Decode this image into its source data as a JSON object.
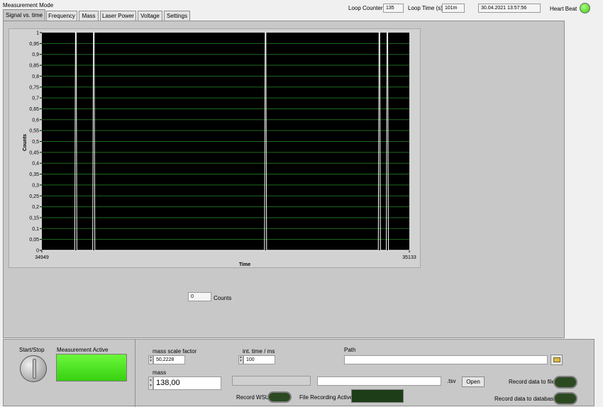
{
  "header": {
    "mode_label": "Measurement Mode",
    "loop_counter_label": "Loop Counter",
    "loop_counter_value": "135",
    "loop_time_label": "Loop Time (s)",
    "loop_time_value": "101m",
    "datetime": "30.04.2021 13:57:56",
    "heartbeat_label": "Heart Beat"
  },
  "tabs": [
    {
      "label": "Signal vs. time"
    },
    {
      "label": "Frequency"
    },
    {
      "label": "Mass"
    },
    {
      "label": "Laser Power"
    },
    {
      "label": "Voltage"
    },
    {
      "label": "Settings"
    }
  ],
  "counts_indicator": {
    "value": "0",
    "label": "Counts"
  },
  "chart_data": {
    "type": "line",
    "xlabel": "Time",
    "ylabel": "Counts",
    "x_range": [
      34949,
      35133
    ],
    "ylim": [
      0,
      1
    ],
    "y_ticks": [
      "0",
      "0,05",
      "0,1",
      "0,15",
      "0,2",
      "0,25",
      "0,3",
      "0,35",
      "0,4",
      "0,45",
      "0,5",
      "0,55",
      "0,6",
      "0,65",
      "0,7",
      "0,75",
      "0,8",
      "0,85",
      "0,9",
      "0,95",
      "1"
    ],
    "x_tick_labels": [
      "34949",
      "35133"
    ],
    "grid": true,
    "background": "#000000",
    "grid_color": "#1e6b1e",
    "line_color": "#ffffff",
    "peaks": [
      {
        "x": 34966,
        "y": 1
      },
      {
        "x": 34975,
        "y": 1
      },
      {
        "x": 35061,
        "y": 1
      },
      {
        "x": 35118,
        "y": 1
      },
      {
        "x": 35122,
        "y": 1
      }
    ]
  },
  "bottom": {
    "start_stop_label": "Start/Stop",
    "measurement_active_label": "Measurement Active",
    "mass_scale_factor_label": "mass scale factor",
    "mass_scale_factor_value": "50,2228",
    "int_time_label": "int. time / ms",
    "int_time_value": "100",
    "mass_label": "mass",
    "mass_value": "138,00",
    "path_label": "Path",
    "path_value": "",
    "tsv_label": ".tsv",
    "open_button": "Open",
    "record_wsu_label": "Record WSU",
    "file_recording_label": "File Recording Active",
    "record_file_label": "Record data to file",
    "record_db_label": "Record data to database"
  },
  "colors": {
    "led_on": "#4ee020",
    "led_off": "#1d3d18",
    "panel": "#c8c8c8"
  }
}
